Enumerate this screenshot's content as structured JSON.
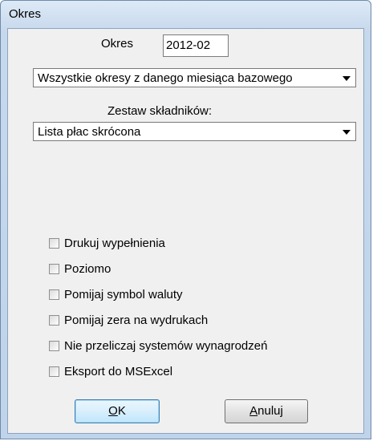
{
  "window": {
    "title": "Okres"
  },
  "period": {
    "label": "Okres",
    "value": "2012-02"
  },
  "period_scope": {
    "selected": "Wszystkie okresy z danego miesiąca bazowego"
  },
  "component_set": {
    "label": "Zestaw składników:",
    "selected": "Lista płac skrócona"
  },
  "options": [
    {
      "label": "Drukuj wypełnienia",
      "checked": false
    },
    {
      "label": "Poziomo",
      "checked": false
    },
    {
      "label": "Pomijaj symbol waluty",
      "checked": false
    },
    {
      "label": "Pomijaj zera na wydrukach",
      "checked": false
    },
    {
      "label": "Nie przeliczaj systemów wynagrodzeń",
      "checked": false
    },
    {
      "label": "Eksport do MSExcel",
      "checked": false
    }
  ],
  "buttons": {
    "ok": {
      "mnemonic": "O",
      "rest": "K"
    },
    "cancel": {
      "mnemonic": "A",
      "rest": "nuluj"
    }
  }
}
